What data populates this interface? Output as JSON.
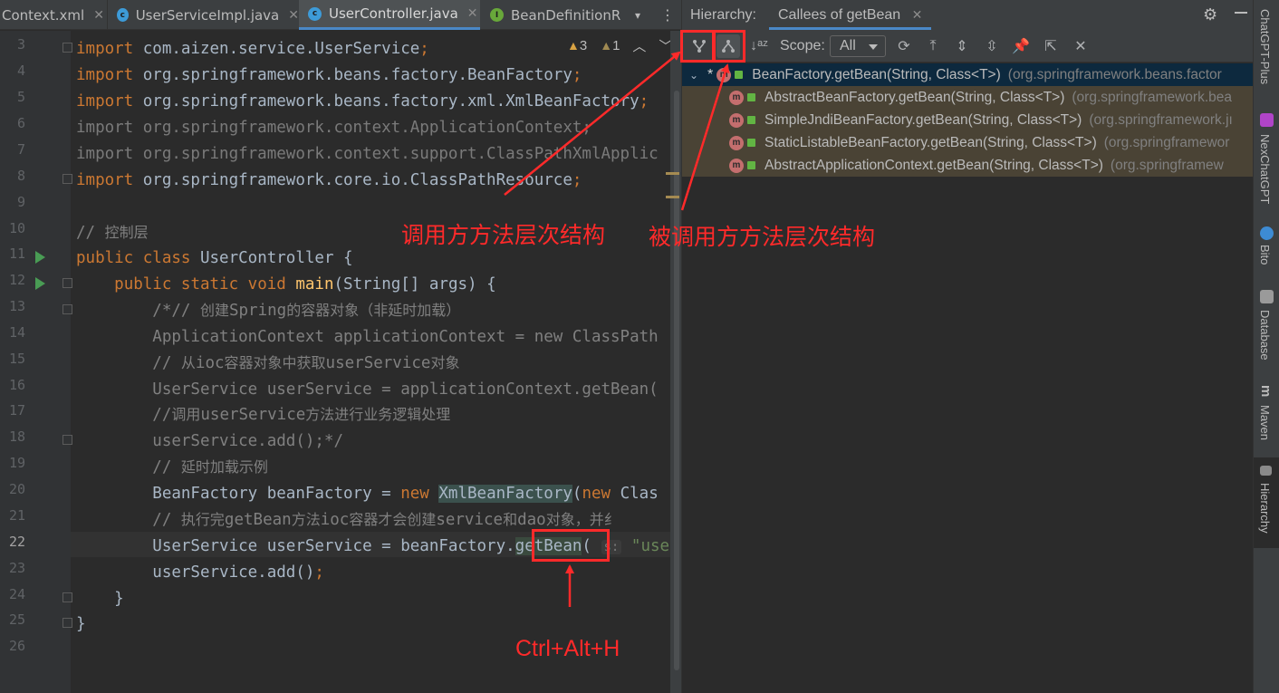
{
  "editor": {
    "tabs": [
      {
        "label": "Context.xml",
        "icon": "xml-file-icon"
      },
      {
        "label": "UserServiceImpl.java",
        "icon": "class-icon"
      },
      {
        "label": "UserController.java",
        "icon": "class-icon"
      },
      {
        "label": "BeanDefinitionR",
        "icon": "interface-icon"
      }
    ],
    "inspections": {
      "warnings": "3",
      "weak_warnings": "1"
    },
    "parameter_hint": "s:",
    "lines": [
      {
        "n": "3",
        "text": "import com.aizen.service.UserService;"
      },
      {
        "n": "4",
        "text": "import org.springframework.beans.factory.BeanFactory;"
      },
      {
        "n": "5",
        "text": "import org.springframework.beans.factory.xml.XmlBeanFactory;"
      },
      {
        "n": "6",
        "text": "import org.springframework.context.ApplicationContext;"
      },
      {
        "n": "7",
        "text": "import org.springframework.context.support.ClassPathXmlApplic"
      },
      {
        "n": "8",
        "text": "import org.springframework.core.io.ClassPathResource;"
      },
      {
        "n": "9",
        "text": ""
      },
      {
        "n": "10",
        "text": "// 控制层"
      },
      {
        "n": "11",
        "text": "public class UserController {"
      },
      {
        "n": "12",
        "text": "public static void main(String[] args) {"
      },
      {
        "n": "13",
        "text": "/*// 创建Spring的容器对象（非延时加载）"
      },
      {
        "n": "14",
        "text": "ApplicationContext applicationContext = new ClassPath"
      },
      {
        "n": "15",
        "text": "// 从ioc容器对象中获取userService对象"
      },
      {
        "n": "16",
        "text": "UserService userService = applicationContext.getBean("
      },
      {
        "n": "17",
        "text": "//调用userService方法进行业务逻辑处理"
      },
      {
        "n": "18",
        "text": "userService.add();*/"
      },
      {
        "n": "19",
        "text": "// 延时加载示例"
      },
      {
        "n": "20",
        "text": "BeanFactory beanFactory = new XmlBeanFactory(new Clas"
      },
      {
        "n": "21",
        "text": "// 执行完getBean方法ioc容器才会创建service和dao对象，并纟"
      },
      {
        "n": "22",
        "text": "UserService userService = beanFactory.getBean( s: \"use"
      },
      {
        "n": "23",
        "text": "userService.add();"
      },
      {
        "n": "24",
        "text": "}"
      },
      {
        "n": "25",
        "text": "}"
      },
      {
        "n": "26",
        "text": ""
      }
    ]
  },
  "hierarchy": {
    "label": "Hierarchy:",
    "tab": "Callees of getBean",
    "scope_label": "Scope:",
    "scope_value": "All",
    "root": {
      "method": "BeanFactory.getBean(String, Class<T>)",
      "package": "(org.springframework.beans.factor"
    },
    "children": [
      {
        "method": "AbstractBeanFactory.getBean(String, Class<T>)",
        "package": "(org.springframework.bea"
      },
      {
        "method": "SimpleJndiBeanFactory.getBean(String, Class<T>)",
        "package": "(org.springframework.jı"
      },
      {
        "method": "StaticListableBeanFactory.getBean(String, Class<T>)",
        "package": "(org.springframewor"
      },
      {
        "method": "AbstractApplicationContext.getBean(String, Class<T>)",
        "package": "(org.springframew"
      }
    ]
  },
  "side_tools": [
    {
      "label": "ChatGPT-Plus"
    },
    {
      "label": "NexChatGPT"
    },
    {
      "label": "Bito"
    },
    {
      "label": "Database"
    },
    {
      "label": "Maven"
    },
    {
      "label": "Hierarchy"
    }
  ],
  "annotations": {
    "caller": "调用方方法层次结构",
    "callee": "被调用方方法层次结构",
    "shortcut": "Ctrl+Alt+H",
    "color": "#ff2a2a"
  }
}
